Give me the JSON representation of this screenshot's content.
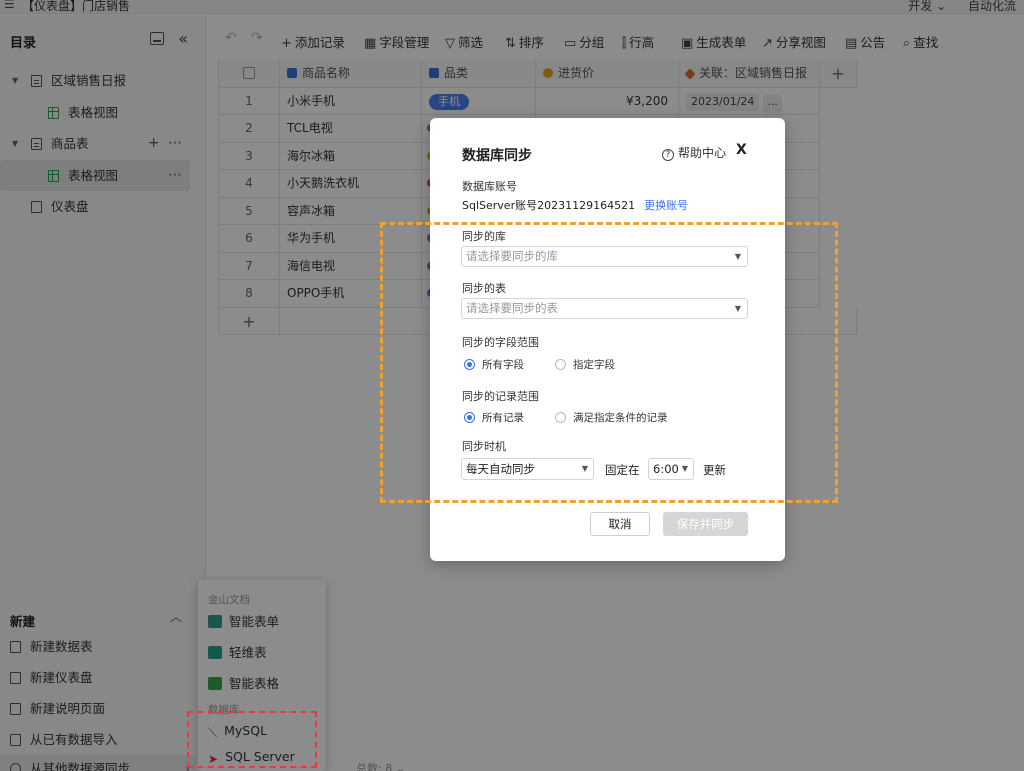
{
  "app": {
    "window_title": "【仪表盘】门店销售",
    "menu_icon": "hamburger-icon",
    "top_right": [
      "开发 ⌄",
      "自动化流"
    ]
  },
  "sidebar": {
    "title": "目录",
    "tree": [
      {
        "label": "区域销售日报",
        "level": 0,
        "icon": "table-icon"
      },
      {
        "label": "表格视图",
        "level": 1,
        "icon": "grid-view-icon"
      },
      {
        "label": "商品表",
        "level": 0,
        "icon": "table-icon"
      },
      {
        "label": "表格视图",
        "level": 1,
        "icon": "grid-view-icon",
        "active": true
      },
      {
        "label": "仪表盘",
        "level": 0,
        "icon": "dashboard-icon"
      }
    ],
    "new_section": {
      "title": "新建",
      "items": [
        "新建数据表",
        "新建仪表盘",
        "新建说明页面",
        "从已有数据导入",
        "从其他数据源同步"
      ]
    }
  },
  "toolbar": {
    "items": [
      "添加记录",
      "字段管理",
      "筛选",
      "排序",
      "分组",
      "行高",
      "生成表单",
      "分享视图",
      "公告",
      "查找"
    ]
  },
  "grid": {
    "columns": [
      "商品名称",
      "品类",
      "进货价",
      "关联：区域销售日报"
    ],
    "rows": [
      {
        "no": "1",
        "name": "小米手机",
        "tag": "手机",
        "price": "¥3,200",
        "link": "2023/01/24"
      },
      {
        "no": "2",
        "name": "TCL电视"
      },
      {
        "no": "3",
        "name": "海尔冰箱"
      },
      {
        "no": "4",
        "name": "小天鹅洗衣机"
      },
      {
        "no": "5",
        "name": "容声冰箱"
      },
      {
        "no": "6",
        "name": "华为手机"
      },
      {
        "no": "7",
        "name": "海信电视"
      },
      {
        "no": "8",
        "name": "OPPO手机"
      }
    ],
    "link_more": "...",
    "add_row": "+",
    "add_col": "+",
    "footer_count": "总数: 8 ⌄"
  },
  "popup_menu": {
    "group1": "金山文档",
    "items1": [
      "智能表单",
      "轻维表",
      "智能表格"
    ],
    "group2": "数据库",
    "items2": [
      "MySQL",
      "SQL Server"
    ]
  },
  "dialog": {
    "title": "数据库同步",
    "help": "帮助中心",
    "close": "X",
    "account_label": "数据库账号",
    "account_value": "SqlServer账号20231129164521",
    "account_link": "更换账号",
    "db_label": "同步的库",
    "db_placeholder": "请选择要同步的库",
    "table_label": "同步的表",
    "table_placeholder": "请选择要同步的表",
    "field_scope_label": "同步的字段范围",
    "field_scope_options": [
      "所有字段",
      "指定字段"
    ],
    "record_scope_label": "同步的记录范围",
    "record_scope_options": [
      "所有记录",
      "满足指定条件的记录"
    ],
    "timing_label": "同步时机",
    "timing_value": "每天自动同步",
    "fixed_at": "固定在",
    "time_value": "6:00",
    "update": "更新",
    "cancel": "取消",
    "save": "保存并同步"
  },
  "colors": {
    "accent": "#3c6ef0",
    "annotation_orange": "#f0a030",
    "annotation_red": "#e83a3a"
  }
}
